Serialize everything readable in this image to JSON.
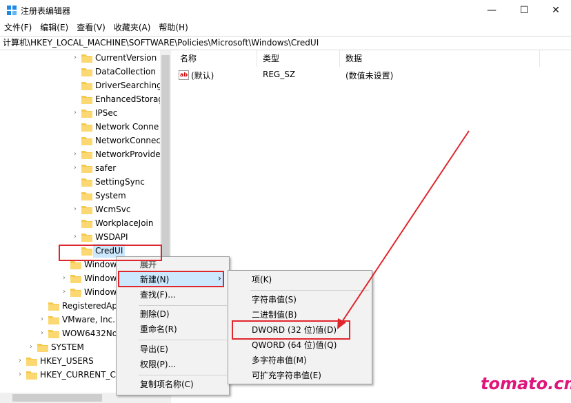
{
  "window": {
    "title": "注册表编辑器",
    "minimize": "—",
    "maximize": "☐",
    "close": "✕"
  },
  "menu": [
    "文件(F)",
    "编辑(E)",
    "查看(V)",
    "收藏夹(A)",
    "帮助(H)"
  ],
  "address": "计算机\\HKEY_LOCAL_MACHINE\\SOFTWARE\\Policies\\Microsoft\\Windows\\CredUI",
  "tree": [
    {
      "label": "CurrentVersion",
      "chev": true
    },
    {
      "label": "DataCollection",
      "chev": false
    },
    {
      "label": "DriverSearching",
      "chev": false
    },
    {
      "label": "EnhancedStorag",
      "chev": false
    },
    {
      "label": "IPSec",
      "chev": true
    },
    {
      "label": "Network Conne",
      "chev": false
    },
    {
      "label": "NetworkConnec",
      "chev": false
    },
    {
      "label": "NetworkProvide",
      "chev": true
    },
    {
      "label": "safer",
      "chev": true
    },
    {
      "label": "SettingSync",
      "chev": false
    },
    {
      "label": "System",
      "chev": false
    },
    {
      "label": "WcmSvc",
      "chev": true
    },
    {
      "label": "WorkplaceJoin",
      "chev": false
    },
    {
      "label": "WSDAPI",
      "chev": true
    },
    {
      "label": "CredUI",
      "chev": false
    },
    {
      "label": "Window",
      "chev": false
    },
    {
      "label": "Window",
      "chev": true
    },
    {
      "label": "Window",
      "chev": true
    },
    {
      "label": "RegisteredAp",
      "chev": false
    },
    {
      "label": "VMware, Inc.",
      "chev": true
    },
    {
      "label": "WOW6432No",
      "chev": true
    },
    {
      "label": "SYSTEM",
      "chev": true
    },
    {
      "label": "HKEY_USERS",
      "chev": true
    },
    {
      "label": "HKEY_CURRENT_CO",
      "chev": true
    }
  ],
  "columns": {
    "name": "名称",
    "type": "类型",
    "data": "数据"
  },
  "values": [
    {
      "name": "(默认)",
      "type": "REG_SZ",
      "data": "(数值未设置)",
      "icon": "ab"
    }
  ],
  "context_menu": {
    "items": [
      "展开",
      "新建(N)",
      "查找(F)...",
      "删除(D)",
      "重命名(R)",
      "导出(E)",
      "权限(P)...",
      "复制项名称(C)"
    ],
    "submenu_arrow": "›"
  },
  "submenu": {
    "items": [
      "项(K)",
      "字符串值(S)",
      "二进制值(B)",
      "DWORD (32 位)值(D)",
      "QWORD (64 位)值(Q)",
      "多字符串值(M)",
      "可扩充字符串值(E)"
    ]
  },
  "watermark": "tomato.cm",
  "colors": {
    "highlight": "#cce8ff",
    "annotation": "#e0262d",
    "watermark": "#e0157c",
    "folder": "#f5c94a"
  }
}
